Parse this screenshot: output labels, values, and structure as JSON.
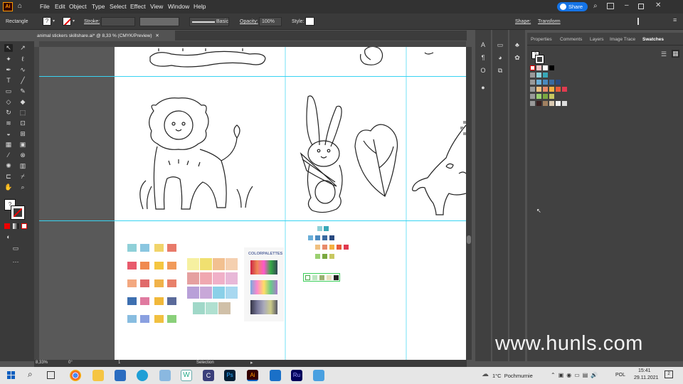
{
  "app": {
    "logo": "Ai"
  },
  "menu": [
    "File",
    "Edit",
    "Object",
    "Type",
    "Select",
    "Effect",
    "View",
    "Window",
    "Help"
  ],
  "share_label": "Share",
  "control": {
    "tool_name": "Rectangle",
    "stroke_label": "Stroke:",
    "brush_label": "Basic",
    "opacity_label": "Opacity:",
    "opacity_value": "100%",
    "style_label": "Style:",
    "shape_label": "Shape:",
    "transform_label": "Transform"
  },
  "document_tab": "animal stickers skillshare.ai* @ 8,33 % (CMYK/Preview)",
  "panels": {
    "tabs": [
      "Properties",
      "Comments",
      "Layers",
      "Image Trace",
      "Swatches"
    ]
  },
  "status": {
    "zoom": "8,33%",
    "angle": "0°",
    "artboard": "1",
    "mode": "Selection"
  },
  "artwork": {
    "colorpalettes_title": "COLORPALETTES"
  },
  "taskbar": {
    "weather": "1°C  Pochmurnie",
    "lang": "POL",
    "time": "15:41",
    "date": "29.11.2021"
  },
  "watermark": "www.hunls.com",
  "colors": {
    "accent": "#1473e6",
    "menubar": "#323232",
    "canvas": "#595959"
  }
}
